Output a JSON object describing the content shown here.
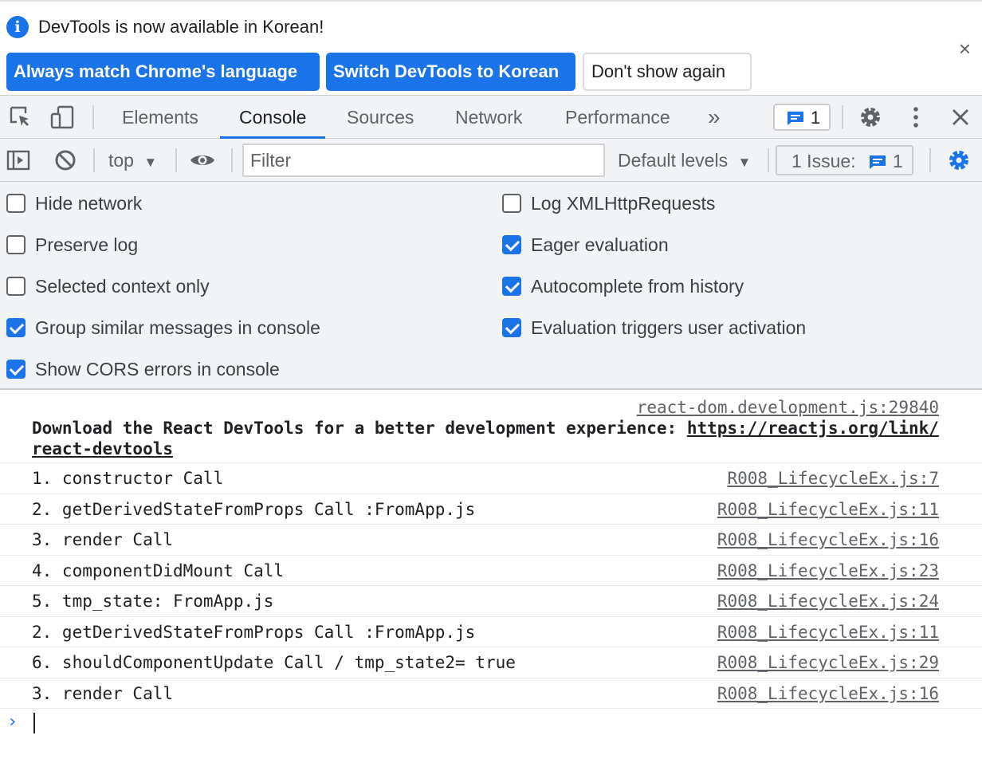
{
  "infobar": {
    "message": "DevTools is now available in Korean!",
    "buttons": [
      "Always match Chrome's language",
      "Switch DevTools to Korean",
      "Don't show again"
    ],
    "close": "×"
  },
  "tabs": {
    "items": [
      "Elements",
      "Console",
      "Sources",
      "Network",
      "Performance"
    ],
    "active": "Console",
    "more": "»",
    "issues_count": "1"
  },
  "console_toolbar": {
    "context": "top",
    "filter_placeholder": "Filter",
    "levels": "Default levels",
    "issue_label": "1 Issue:",
    "issue_count": "1"
  },
  "settings": {
    "left": [
      {
        "label": "Hide network",
        "checked": false
      },
      {
        "label": "Preserve log",
        "checked": false
      },
      {
        "label": "Selected context only",
        "checked": false
      },
      {
        "label": "Group similar messages in console",
        "checked": true
      },
      {
        "label": "Show CORS errors in console",
        "checked": true
      }
    ],
    "right": [
      {
        "label": "Log XMLHttpRequests",
        "checked": false
      },
      {
        "label": "Eager evaluation",
        "checked": true
      },
      {
        "label": "Autocomplete from history",
        "checked": true
      },
      {
        "label": "Evaluation triggers user activation",
        "checked": true
      }
    ]
  },
  "messages": {
    "react": {
      "source": "react-dom.development.js:29840",
      "text": "Download the React DevTools for a better development experience: ",
      "link": "https://reactjs.org/link/react-devtools"
    },
    "logs": [
      {
        "text": "1. constructor Call",
        "source": "R008_LifecycleEx.js:7"
      },
      {
        "text": "2. getDerivedStateFromProps Call :FromApp.js",
        "source": "R008_LifecycleEx.js:11"
      },
      {
        "text": "3. render Call",
        "source": "R008_LifecycleEx.js:16"
      },
      {
        "text": "4. componentDidMount Call",
        "source": "R008_LifecycleEx.js:23"
      },
      {
        "text": "5. tmp_state: FromApp.js",
        "source": "R008_LifecycleEx.js:24"
      },
      {
        "text": "2. getDerivedStateFromProps Call :FromApp.js",
        "source": "R008_LifecycleEx.js:11"
      },
      {
        "text": "6. shouldComponentUpdate Call / tmp_state2= true",
        "source": "R008_LifecycleEx.js:29"
      },
      {
        "text": "3. render Call",
        "source": "R008_LifecycleEx.js:16"
      }
    ],
    "prompt": "›"
  },
  "colors": {
    "accent": "#1a73e8",
    "toolbar_bg": "#f1f3f4",
    "text": "#202124",
    "muted": "#5f6368"
  },
  "icons": [
    "info-icon",
    "inspect-element-icon",
    "device-toolbar-icon",
    "more-tabs-icon",
    "issues-bubble-icon",
    "gear-icon",
    "kebab-menu-icon",
    "close-icon",
    "sidebar-toggle-icon",
    "clear-console-icon",
    "dropdown-arrow-icon",
    "eye-icon",
    "settings-gear-icon",
    "prompt-chevron-icon"
  ]
}
